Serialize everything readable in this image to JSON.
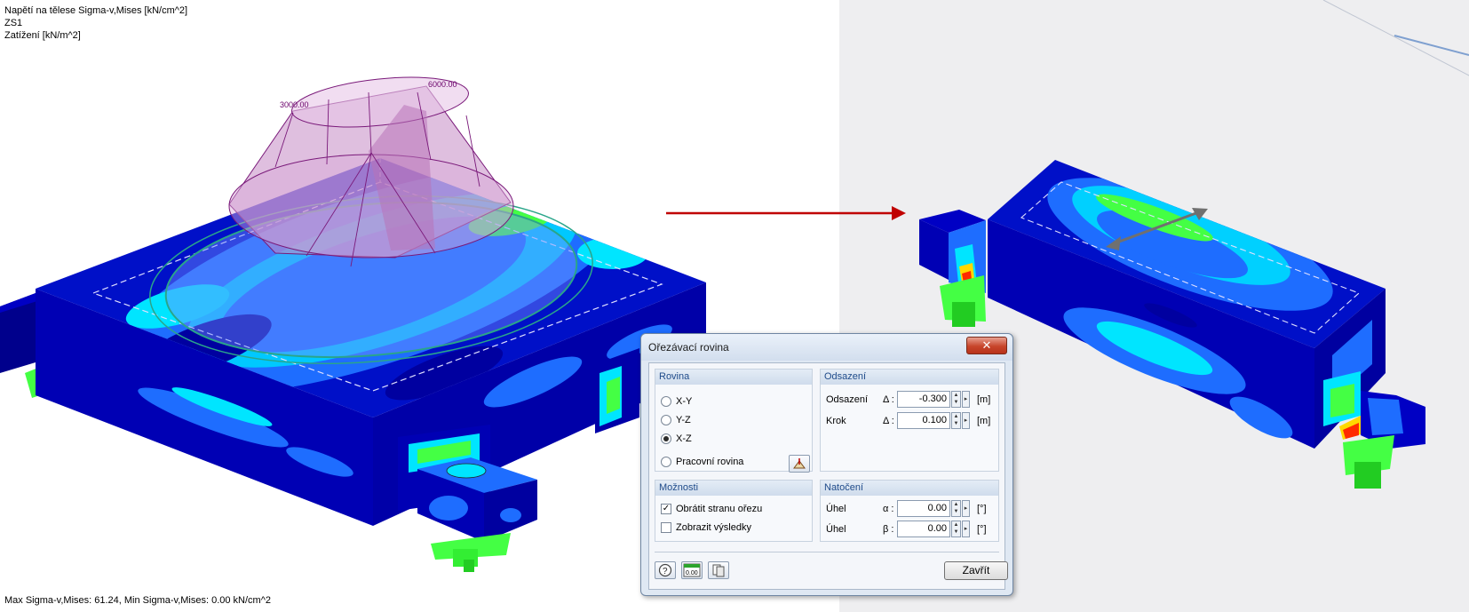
{
  "viewport": {
    "info_lines": [
      "Napětí na tělese Sigma-v,Mises [kN/cm^2]",
      "ZS1",
      "Zatížení [kN/m^2]"
    ],
    "load_labels": [
      "3000.00",
      "6000.00"
    ],
    "footer": "Max Sigma-v,Mises: 61.24, Min Sigma-v,Mises: 0.00 kN/cm^2",
    "colors": {
      "stress_low": "#0000b4",
      "stress_mid": "#1e6dff",
      "stress_cyan": "#00e5ff",
      "stress_green": "#44ff44",
      "stress_high": "#ff2a00",
      "load": "#c58ac5",
      "arrow": "#c00000"
    }
  },
  "dialog": {
    "title": "Ořezávací rovina",
    "close_symbol": "✕",
    "rovina": {
      "header": "Rovina",
      "options": [
        {
          "label": "X-Y",
          "selected": false
        },
        {
          "label": "Y-Z",
          "selected": false
        },
        {
          "label": "X-Z",
          "selected": true
        }
      ],
      "work_plane_label": "Pracovní rovina"
    },
    "odsazeni": {
      "header": "Odsazení",
      "rows": [
        {
          "label": "Odsazení",
          "symbol": "Δ :",
          "value": "-0.300",
          "unit": "[m]"
        },
        {
          "label": "Krok",
          "symbol": "Δ :",
          "value": "0.100",
          "unit": "[m]"
        }
      ]
    },
    "moznosti": {
      "header": "Možnosti",
      "checks": [
        {
          "label": "Obrátit stranu ořezu",
          "checked": true
        },
        {
          "label": "Zobrazit výsledky",
          "checked": false
        }
      ]
    },
    "natoceni": {
      "header": "Natočení",
      "rows": [
        {
          "label": "Úhel",
          "symbol": "α :",
          "value": "0.00",
          "unit": "[°]"
        },
        {
          "label": "Úhel",
          "symbol": "β :",
          "value": "0.00",
          "unit": "[°]"
        }
      ]
    },
    "close_button": "Zavřít",
    "icons": [
      "help-icon",
      "numeric-values-icon",
      "copy-icon"
    ],
    "zero_label": "0.00"
  }
}
